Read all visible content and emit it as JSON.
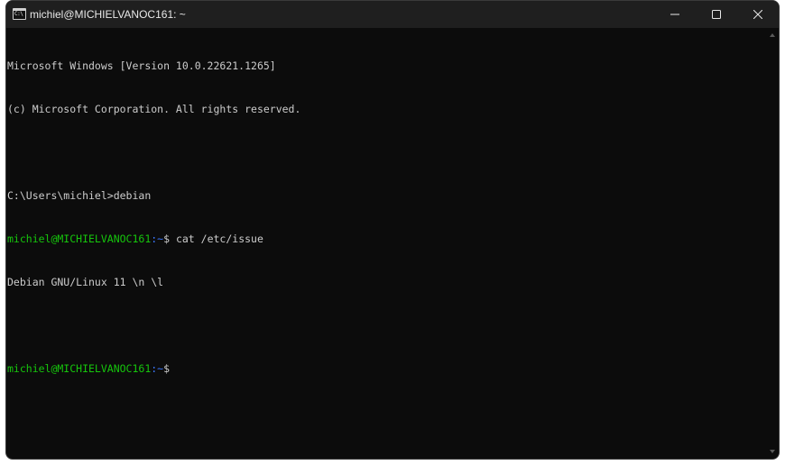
{
  "window": {
    "title": "michiel@MICHIELVANOC161: ~",
    "icon": "console-icon",
    "icon_glyph": "C:\\",
    "controls": [
      "minimize-icon",
      "maximize-icon",
      "close-icon"
    ]
  },
  "terminal": {
    "line1": "Microsoft Windows [Version 10.0.22621.1265]",
    "line2": "(c) Microsoft Corporation. All rights reserved.",
    "line3": "C:\\Users\\michiel>debian",
    "prompt1_user": "michiel@MICHIELVANOC161",
    "prompt1_path": ":~",
    "prompt1_cmd": "$ cat /etc/issue",
    "output1": "Debian GNU/Linux 11 \\n \\l",
    "prompt2_user": "michiel@MICHIELVANOC161",
    "prompt2_path": ":~",
    "prompt2_cmd": "$"
  },
  "colors": {
    "background": "#0c0c0c",
    "titlebar": "#1f1f1f",
    "text": "#cccccc",
    "prompt_user": "#16c60c",
    "prompt_path": "#3b78ff"
  }
}
